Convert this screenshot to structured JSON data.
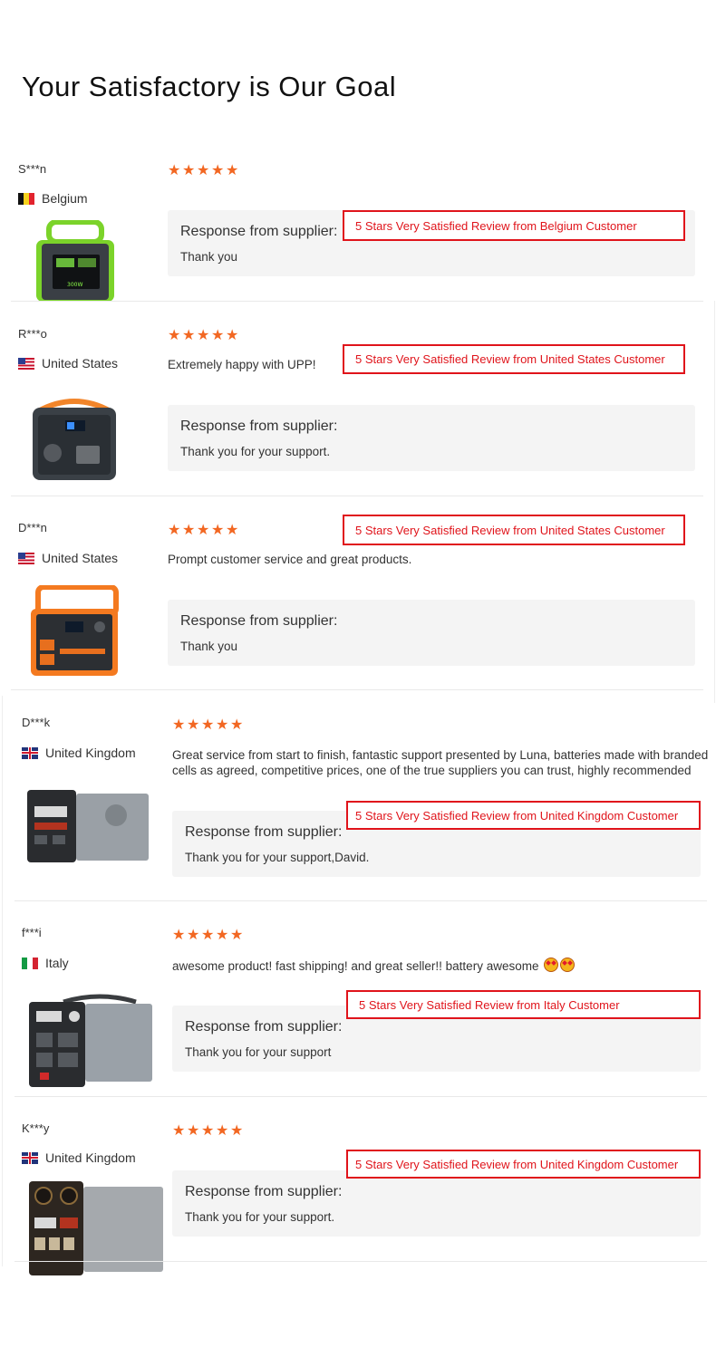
{
  "page": {
    "title": "Your Satisfactory is Our Goal"
  },
  "colors": {
    "star": "#f26722",
    "badge": "#e0141b",
    "panel": "#f4f4f4"
  },
  "reviews": [
    {
      "name": "S***n",
      "country": "Belgium",
      "flag": "belgium-flag",
      "stars": 5,
      "comment": "",
      "response_title": "Response from supplier:",
      "response_text": "Thank you",
      "badge": "5 Stars Very Satisfied Review from Belgium Customer",
      "product": "green-power-station-image"
    },
    {
      "name": "R***o",
      "country": "United States",
      "flag": "us-flag",
      "stars": 5,
      "comment": "Extremely happy with UPP!",
      "response_title": "Response from supplier:",
      "response_text": "Thank you for your support.",
      "badge": "5 Stars Very Satisfied Review from United States Customer",
      "product": "orange-handle-power-station-image"
    },
    {
      "name": "D***n",
      "country": "United States",
      "flag": "us-flag",
      "stars": 5,
      "comment": "Prompt customer service and great products.",
      "response_title": "Response from supplier:",
      "response_text": "Thank you",
      "badge": "5 Stars Very Satisfied Review from United States Customer",
      "product": "orange-frame-power-station-image"
    },
    {
      "name": "D***k",
      "country": "United Kingdom",
      "flag": "uk-flag",
      "stars": 5,
      "comment_line1": "Great service from start to finish, fantastic support presented by Luna, batteries made with branded",
      "comment_line2": "cells as agreed, competitive prices, one of the true suppliers you can trust, highly recommended",
      "response_title": "Response from supplier:",
      "response_text": "Thank you for your support,David.",
      "badge": "5 Stars Very Satisfied Review from United Kingdom Customer",
      "product": "grey-box-power-station-image"
    },
    {
      "name": "f***i",
      "country": "Italy",
      "flag": "italy-flag",
      "stars": 5,
      "comment": "awesome product! fast shipping! and great seller!! battery awesome",
      "response_title": "Response from supplier:",
      "response_text": "Thank you for your support",
      "badge": "5 Stars Very Satisfied Review from Italy Customer",
      "product": "silver-power-station-image"
    },
    {
      "name": "K***y",
      "country": "United Kingdom",
      "flag": "uk-flag",
      "stars": 5,
      "comment": "",
      "response_title": "Response from supplier:",
      "response_text": "Thank you for your support.",
      "badge": "5 Stars Very Satisfied Review from United Kingdom Customer",
      "product": "large-silver-power-station-image"
    }
  ]
}
